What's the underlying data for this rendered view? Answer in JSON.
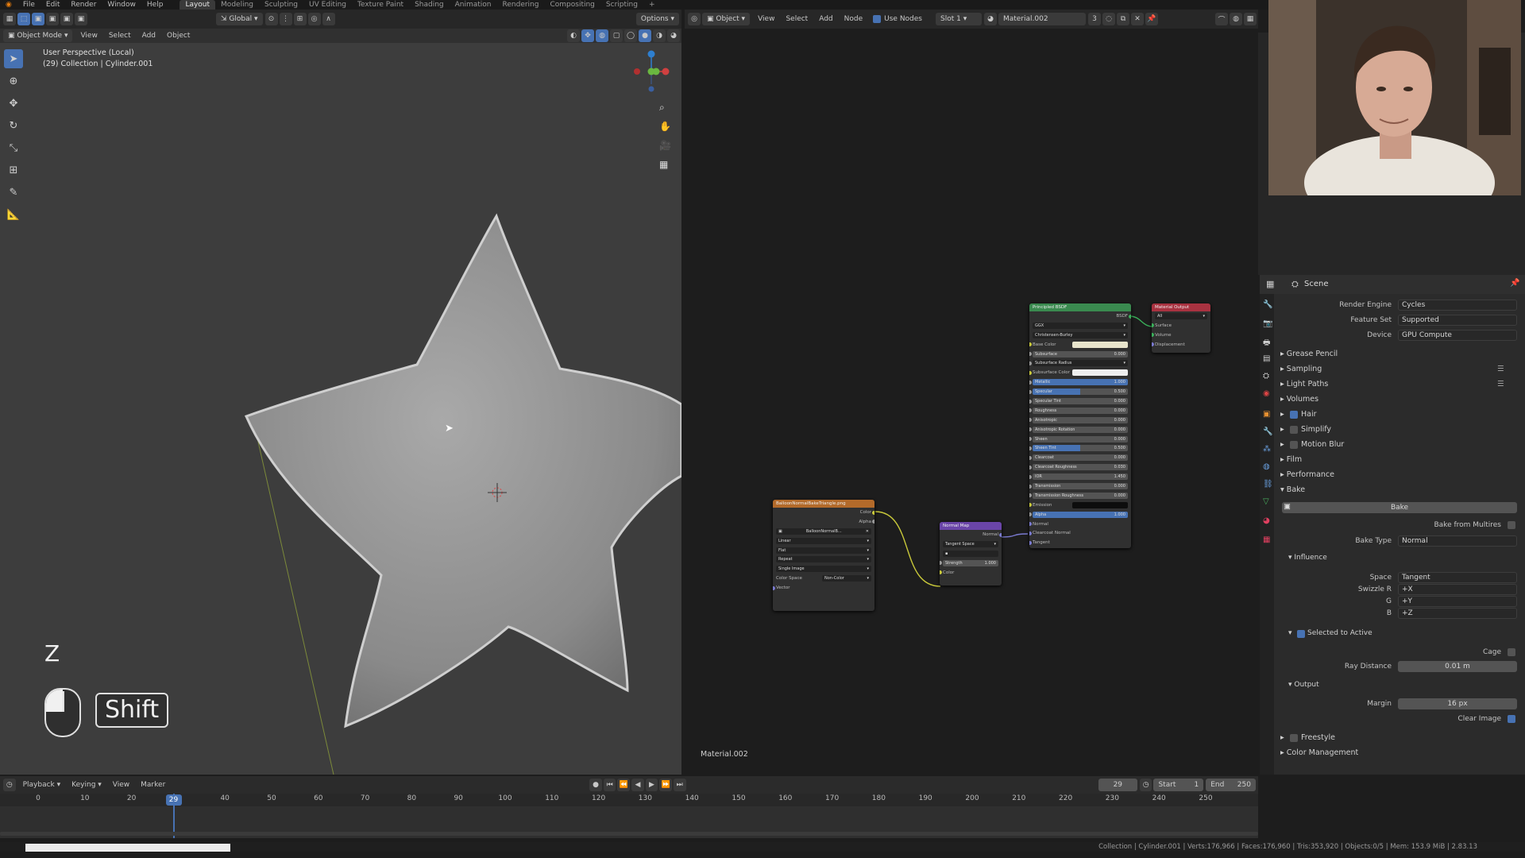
{
  "top_menu": {
    "items": [
      "File",
      "Edit",
      "Render",
      "Window",
      "Help"
    ],
    "workspaces": [
      "Layout",
      "Modeling",
      "Sculpting",
      "UV Editing",
      "Texture Paint",
      "Shading",
      "Animation",
      "Rendering",
      "Compositing",
      "Scripting"
    ],
    "active_workspace": "Layout",
    "add_tab": "+"
  },
  "viewport": {
    "transform_orientation": "Global",
    "options_label": "Options",
    "mode": "Object Mode",
    "menus": [
      "View",
      "Select",
      "Add",
      "Object"
    ],
    "overlay_title": "User Perspective (Local)",
    "overlay_subtitle": "(29) Collection | Cylinder.001",
    "key_z": "Z",
    "key_shift": "Shift"
  },
  "node_editor": {
    "type": "Object",
    "menus": [
      "View",
      "Select",
      "Add",
      "Node"
    ],
    "use_nodes_label": "Use Nodes",
    "slot": "Slot 1",
    "material": "Material.002",
    "users": "3",
    "footer_material": "Material.002",
    "nodes": {
      "principled": {
        "title": "Principled BSDF",
        "output": "BSDF",
        "distribution": "GGX",
        "subsurface_method": "Christensen-Burley",
        "rows": [
          {
            "label": "Base Color",
            "kind": "color",
            "color": "#e8e4cc"
          },
          {
            "label": "Subsurface",
            "value": "0.000"
          },
          {
            "label": "Subsurface Radius",
            "kind": "dropdown"
          },
          {
            "label": "Subsurface Color",
            "kind": "color",
            "color": "#eeeeee"
          },
          {
            "label": "Metallic",
            "value": "1.000",
            "fill": "100%"
          },
          {
            "label": "Specular",
            "value": "0.500",
            "fill": "50%"
          },
          {
            "label": "Specular Tint",
            "value": "0.000"
          },
          {
            "label": "Roughness",
            "value": "0.000"
          },
          {
            "label": "Anisotropic",
            "value": "0.000"
          },
          {
            "label": "Anisotropic Rotation",
            "value": "0.000"
          },
          {
            "label": "Sheen",
            "value": "0.000"
          },
          {
            "label": "Sheen Tint",
            "value": "0.500",
            "fill": "50%"
          },
          {
            "label": "Clearcoat",
            "value": "0.000"
          },
          {
            "label": "Clearcoat Roughness",
            "value": "0.030"
          },
          {
            "label": "IOR",
            "value": "1.450"
          },
          {
            "label": "Transmission",
            "value": "0.000"
          },
          {
            "label": "Transmission Roughness",
            "value": "0.000"
          },
          {
            "label": "Emission",
            "kind": "color",
            "color": "#0d0d0d"
          },
          {
            "label": "Alpha",
            "value": "1.000",
            "fill": "100%"
          },
          {
            "label": "Normal",
            "kind": "socket"
          },
          {
            "label": "Clearcoat Normal",
            "kind": "socket"
          },
          {
            "label": "Tangent",
            "kind": "socket"
          }
        ]
      },
      "output": {
        "title": "Material Output",
        "target": "All",
        "sockets": [
          "Surface",
          "Volume",
          "Displacement"
        ]
      },
      "image": {
        "title": "BalloonNormalBakeTriangle.png",
        "outputs": [
          "Color",
          "Alpha"
        ],
        "image_name": "BalloonNormalB...",
        "options": [
          "Linear",
          "Flat",
          "Repeat",
          "Single Image"
        ],
        "color_space_label": "Color Space",
        "color_space": "Non-Color",
        "input": "Vector"
      },
      "normal_map": {
        "title": "Normal Map",
        "output": "Normal",
        "space": "Tangent Space",
        "strength_label": "Strength",
        "strength": "1.000",
        "input": "Color"
      }
    }
  },
  "properties": {
    "context": "Scene",
    "render_engine_label": "Render Engine",
    "render_engine": "Cycles",
    "feature_set_label": "Feature Set",
    "feature_set": "Supported",
    "device_label": "Device",
    "device": "GPU Compute",
    "panels": [
      "Grease Pencil",
      "Sampling",
      "Light Paths",
      "Volumes",
      "Hair",
      "Simplify",
      "Motion Blur",
      "Film",
      "Performance",
      "Bake"
    ],
    "bake_button": "Bake",
    "bake_from_multires": "Bake from Multires",
    "bake_type_label": "Bake Type",
    "bake_type": "Normal",
    "influence": "Influence",
    "space_label": "Space",
    "space": "Tangent",
    "swizzle_r_label": "Swizzle R",
    "swizzle_r": "+X",
    "g_label": "G",
    "g": "+Y",
    "b_label": "B",
    "b": "+Z",
    "selected_to_active": "Selected to Active",
    "cage_label": "Cage",
    "ray_distance_label": "Ray Distance",
    "ray_distance": "0.01 m",
    "output_label": "Output",
    "margin_label": "Margin",
    "margin": "16 px",
    "clear_image": "Clear Image",
    "freestyle": "Freestyle",
    "color_management": "Color Management"
  },
  "timeline": {
    "menus": [
      "Playback",
      "Keying",
      "View",
      "Marker"
    ],
    "current_frame": "29",
    "start_label": "Start",
    "start": "1",
    "end_label": "End",
    "end": "250",
    "ticks": [
      "0",
      "10",
      "20",
      "40",
      "50",
      "60",
      "70",
      "80",
      "90",
      "100",
      "110",
      "120",
      "130",
      "140",
      "150",
      "160",
      "170",
      "180",
      "190",
      "200",
      "210",
      "220",
      "230",
      "240",
      "250"
    ],
    "playhead": "29",
    "frame_range": [
      0,
      250
    ]
  },
  "statusbar": {
    "text": "Collection | Cylinder.001 | Verts:176,966 | Faces:176,960 | Tris:353,920 | Objects:0/5 | Mem: 153.9 MiB | 2.83.13"
  },
  "colors": {
    "accent": "#4772b3",
    "principled_header": "#3a8a4f",
    "output_header": "#a83240",
    "image_header": "#b36a2a",
    "normalmap_header": "#6a45a8"
  }
}
